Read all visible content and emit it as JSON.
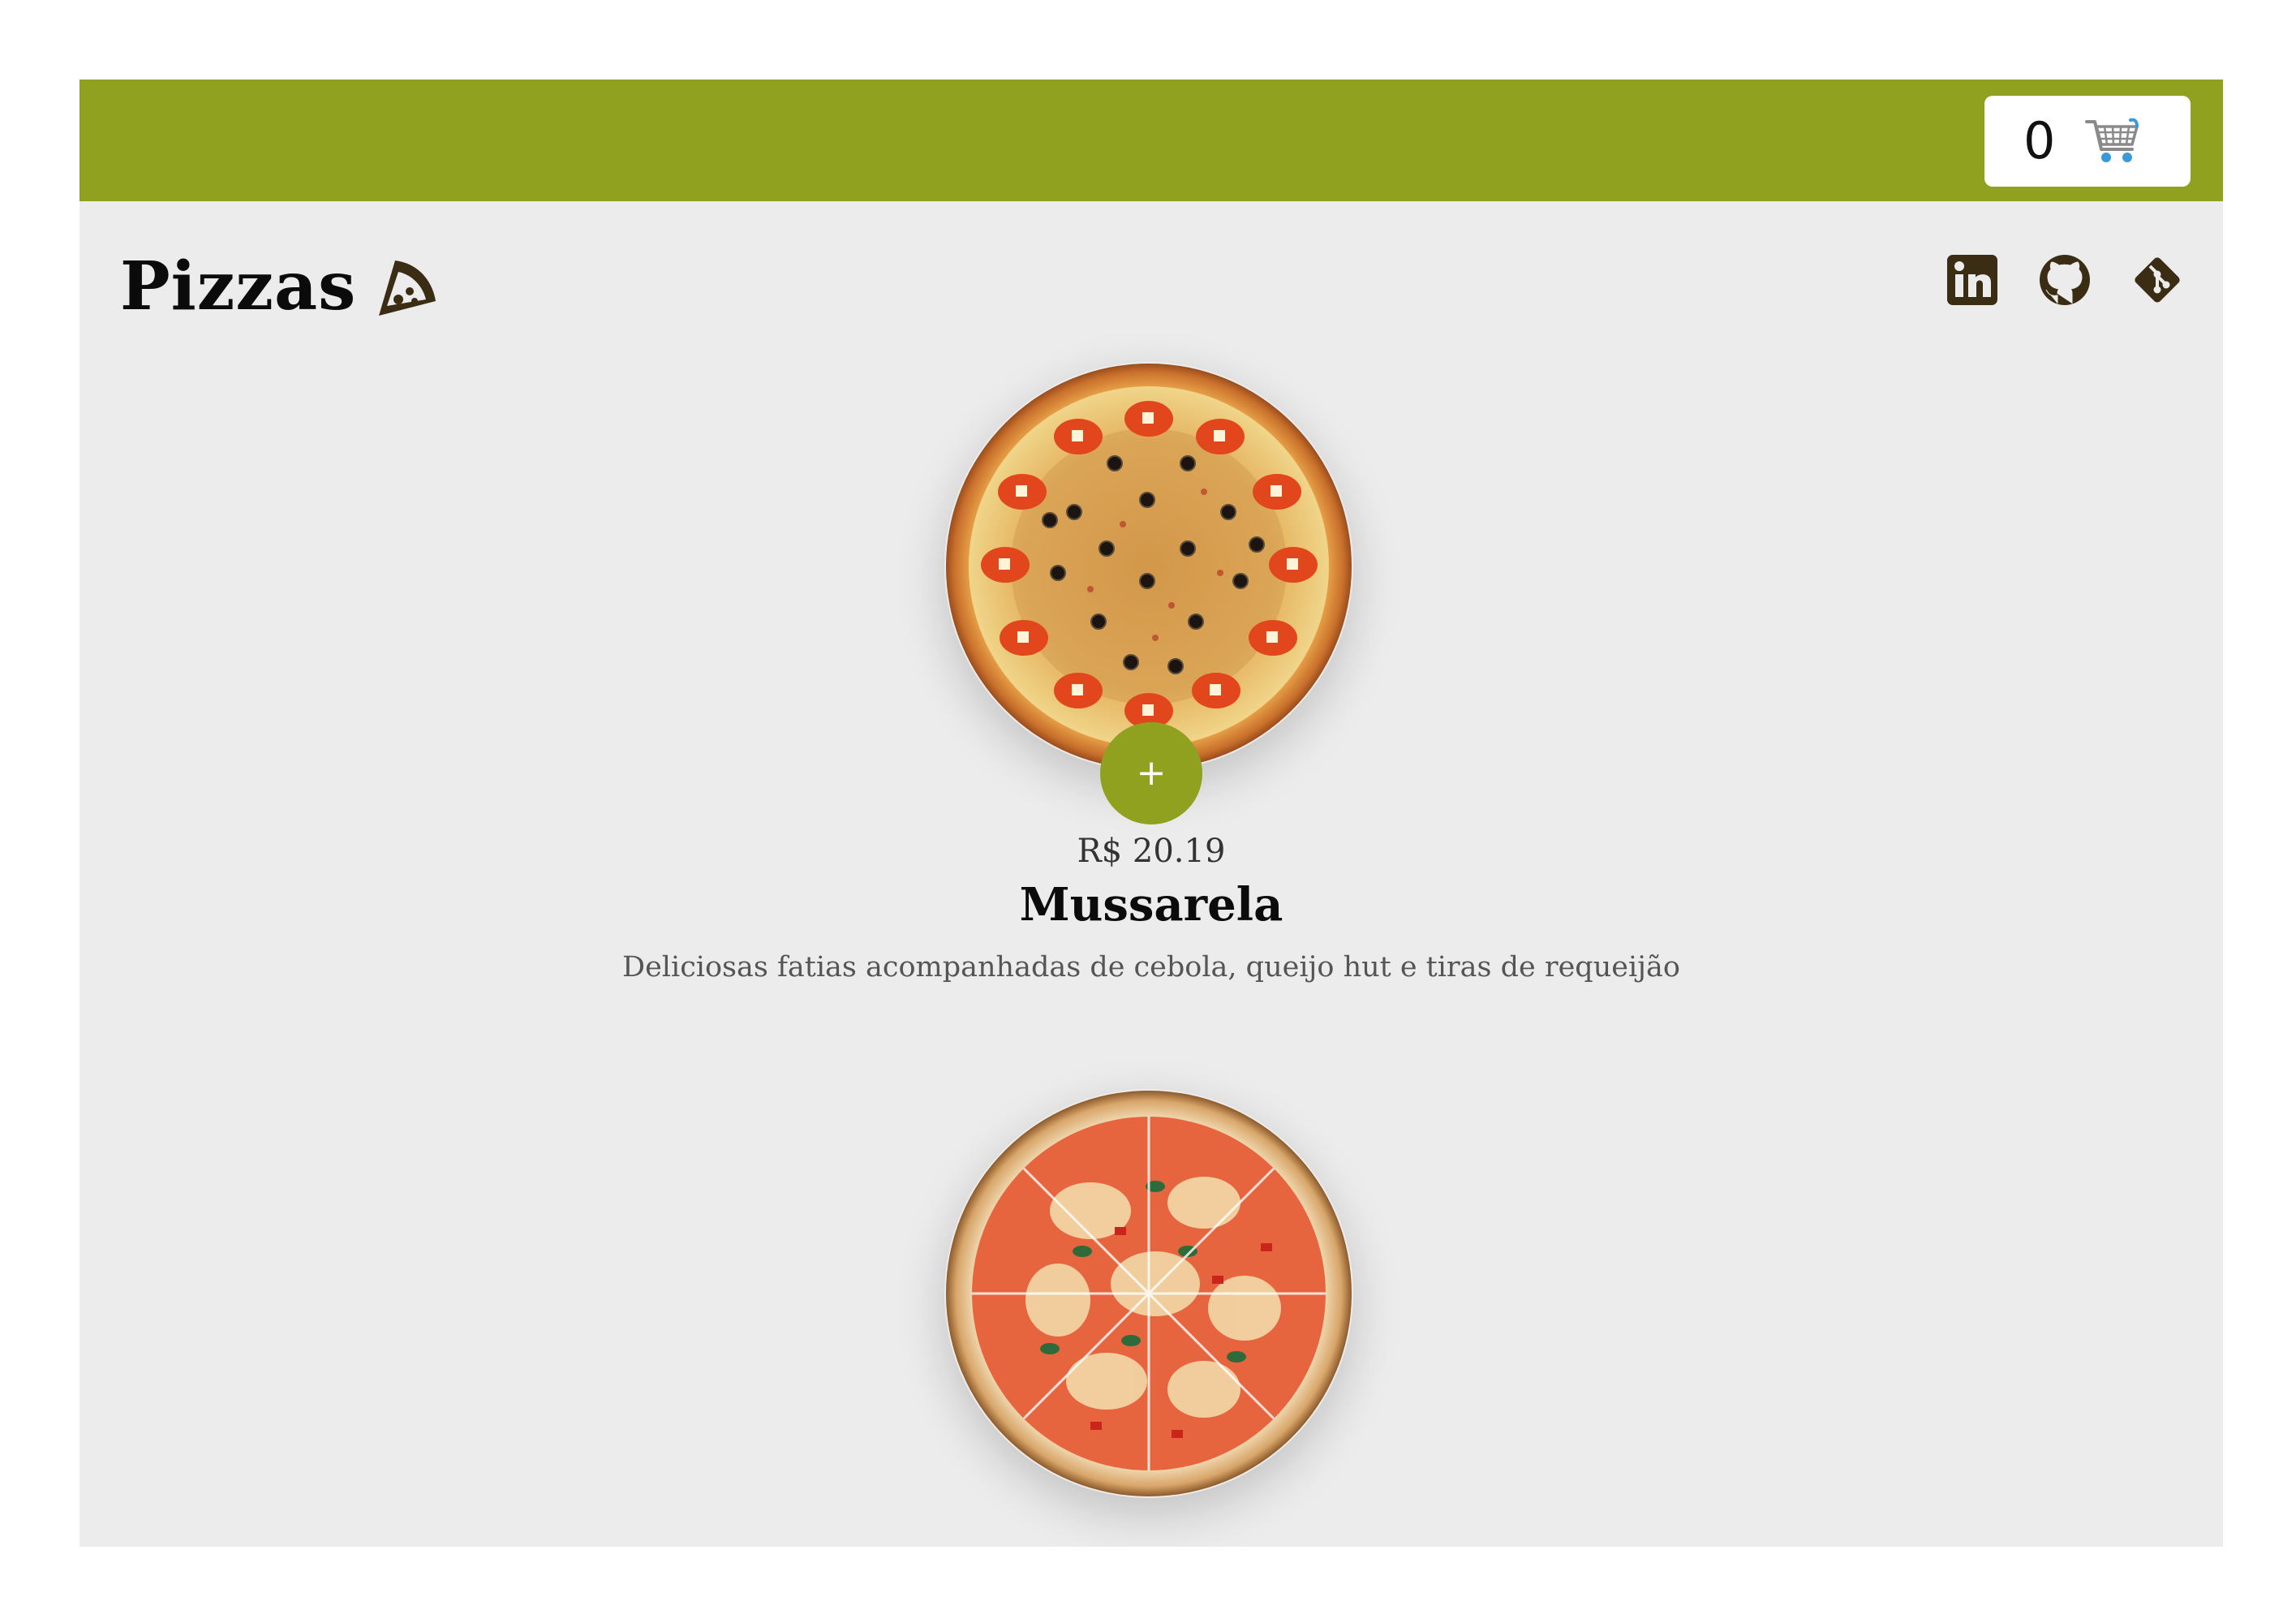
{
  "header": {
    "cart_count": "0",
    "cart_icon": "shopping-cart-icon",
    "accent_color": "#8fa11e"
  },
  "page": {
    "title": "Pizzas",
    "title_icon": "pizza-slice-icon"
  },
  "social": [
    {
      "name": "linkedin",
      "icon": "linkedin-icon"
    },
    {
      "name": "github",
      "icon": "github-icon"
    },
    {
      "name": "git",
      "icon": "git-icon"
    }
  ],
  "products": [
    {
      "price": "R$ 20.19",
      "name": "Mussarela",
      "description": "Deliciosas fatias acompanhadas de cebola, queijo hut e tiras de requeijão",
      "add_label": "+"
    },
    {
      "image": "pizza-vegetables-image"
    }
  ]
}
